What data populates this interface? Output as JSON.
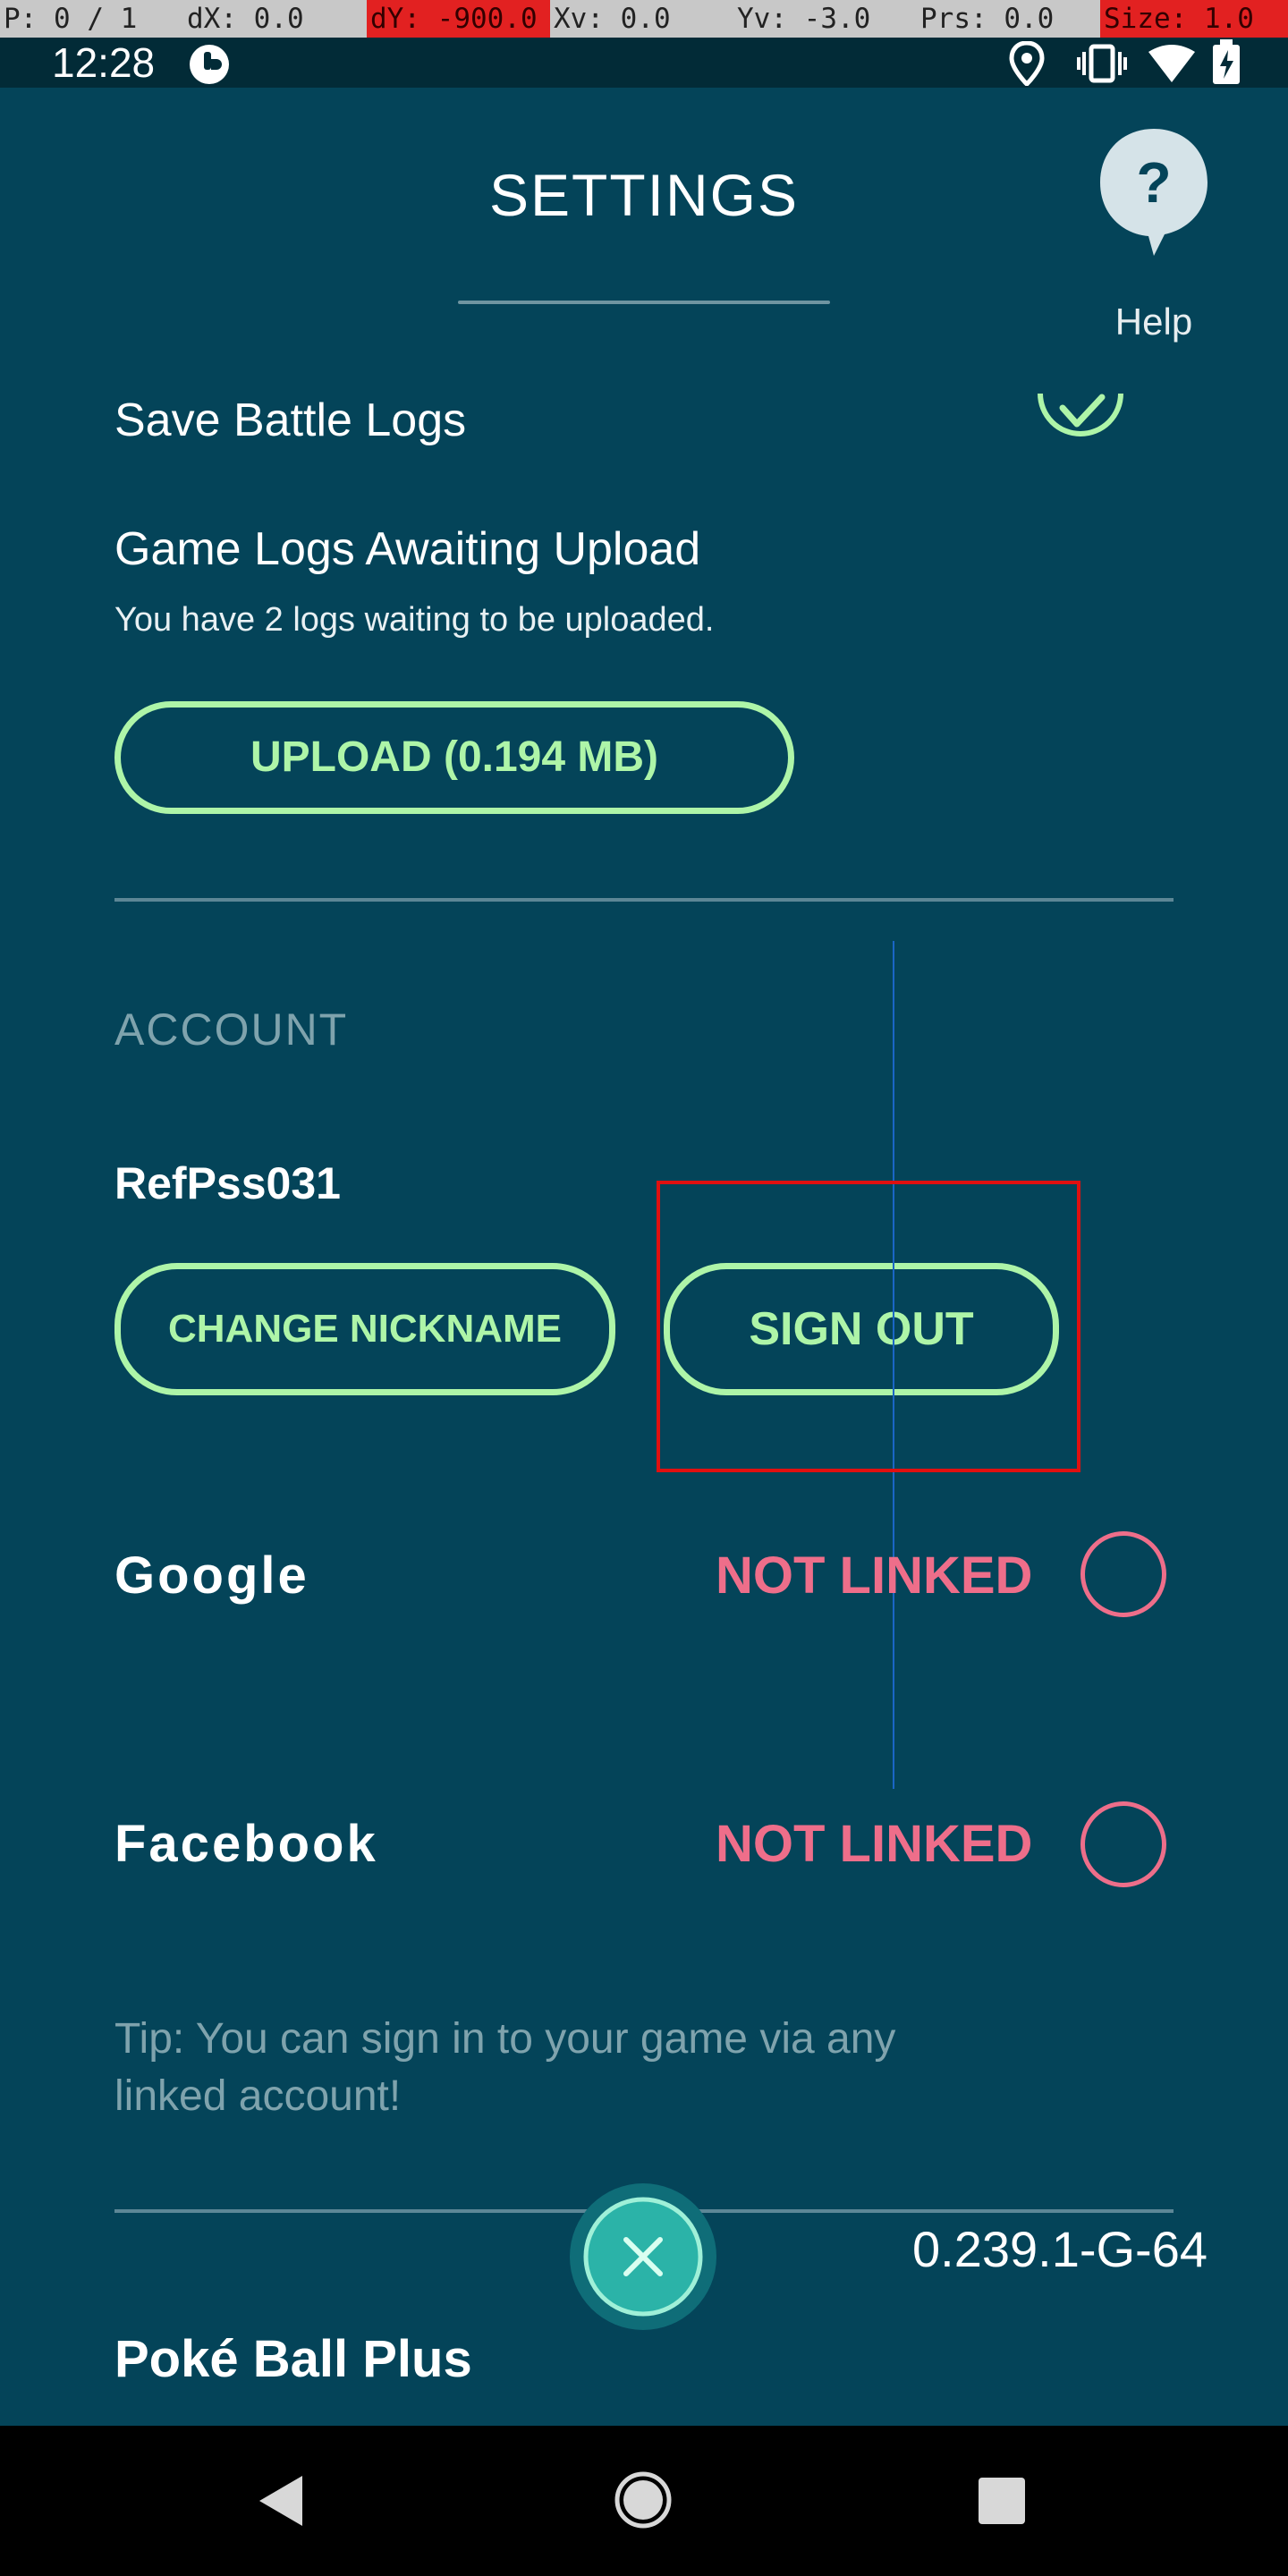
{
  "debug_bar": {
    "pointer": "P: 0 / 1",
    "dx": "dX: 0.0",
    "dy": "dY: -900.0",
    "xv": "Xv: 0.0",
    "yv": "Yv: -3.0",
    "prs": "Prs: 0.0",
    "size": "Size: 1.0"
  },
  "status_bar": {
    "time": "12:28",
    "icons": [
      "app-notification-icon",
      "location-icon",
      "vibrate-icon",
      "wifi-icon",
      "battery-charging-icon"
    ]
  },
  "header": {
    "title": "SETTINGS",
    "help_label": "Help",
    "help_icon_glyph": "?"
  },
  "settings": {
    "save_battle_logs_label": "Save Battle Logs",
    "save_battle_logs_checked": true,
    "game_logs_heading": "Game Logs Awaiting Upload",
    "game_logs_subtext": "You have 2 logs waiting to be uploaded.",
    "upload_button_label": "UPLOAD (0.194 MB)"
  },
  "account": {
    "heading": "ACCOUNT",
    "nickname": "RefPss031",
    "change_nickname_label": "CHANGE NICKNAME",
    "sign_out_label": "SIGN OUT",
    "providers": [
      {
        "name": "Google",
        "status": "NOT LINKED"
      },
      {
        "name": "Facebook",
        "status": "NOT LINKED"
      }
    ],
    "tip": "Tip: You can sign in to your game via any linked account!"
  },
  "footer": {
    "version": "0.239.1-G-64",
    "next_section": "Poké Ball Plus"
  },
  "colors": {
    "background": "#044459",
    "accent_green": "#aef5a8",
    "not_linked_pink": "#ee6e8a",
    "muted_text": "#7fa3ad",
    "highlight_red": "#e01010"
  }
}
